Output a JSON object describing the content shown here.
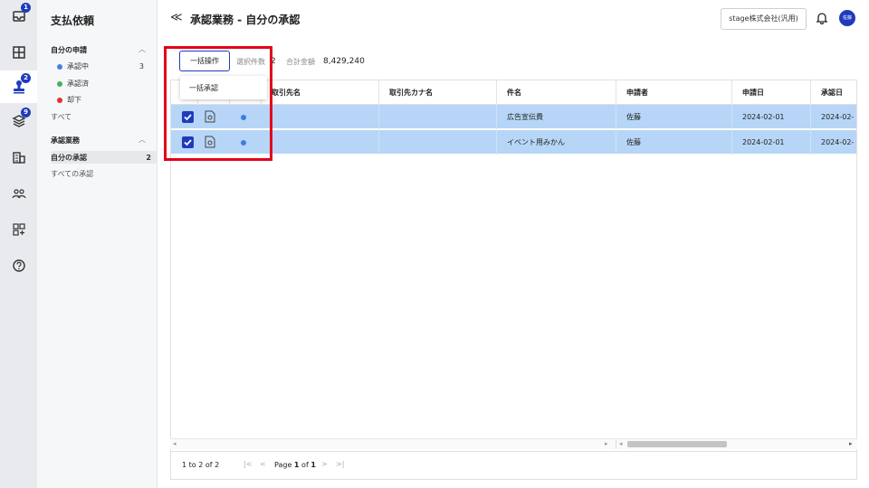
{
  "rail": {
    "items": [
      {
        "icon": "inbox-icon",
        "badge": "1"
      },
      {
        "icon": "ledger-icon",
        "badge": ""
      },
      {
        "icon": "stamp-icon",
        "badge": "2"
      },
      {
        "icon": "layers-icon",
        "badge": "9"
      },
      {
        "icon": "building-icon",
        "badge": ""
      },
      {
        "icon": "users-icon",
        "badge": ""
      },
      {
        "icon": "apps-add-icon",
        "badge": ""
      },
      {
        "icon": "help-icon",
        "badge": ""
      }
    ]
  },
  "subnav": {
    "title": "支払依頼",
    "my_requests": {
      "heading": "自分の申請",
      "items": [
        {
          "label": "承認中",
          "count": "3",
          "color": "#4a7fe0"
        },
        {
          "label": "承認済",
          "count": "",
          "color": "#3cb55a"
        },
        {
          "label": "却下",
          "count": "",
          "color": "#e0312f"
        }
      ],
      "all": "すべて"
    },
    "approvals": {
      "heading": "承認業務",
      "mine": {
        "label": "自分の承認",
        "count": "2"
      },
      "all": "すべての承認"
    }
  },
  "header": {
    "back_glyph": "≪",
    "title": "承認業務 - 自分の承認",
    "company": "stage株式会社(汎用)",
    "avatar_text": "佐藤"
  },
  "toolbar": {
    "bulk_label": "一括操作",
    "selected_label": "選択件数",
    "selected_value": "2",
    "total_label": "合計金額",
    "total_value": "8,429,240"
  },
  "dropdown": {
    "item": "一括承認"
  },
  "table": {
    "columns": [
      "取引先名",
      "取引先カナ名",
      "件名",
      "申請者",
      "申請日",
      "承認日"
    ],
    "rows": [
      {
        "vendor": "",
        "kana": "",
        "subject": "広告宣伝費",
        "applicant": "佐藤",
        "applied": "2024-02-01",
        "approved": "2024-02-"
      },
      {
        "vendor": "",
        "kana": "",
        "subject": "イベント用みかん",
        "applicant": "佐藤",
        "applied": "2024-02-01",
        "approved": "2024-02-"
      }
    ]
  },
  "pager": {
    "range": "1 to 2 of 2",
    "page_prefix": "Page",
    "page_current": "1",
    "page_of": "of",
    "page_total": "1"
  },
  "colors": {
    "accent": "#1f3bbd",
    "selected_row": "#b7d6f7",
    "highlight": "#e3001b"
  }
}
